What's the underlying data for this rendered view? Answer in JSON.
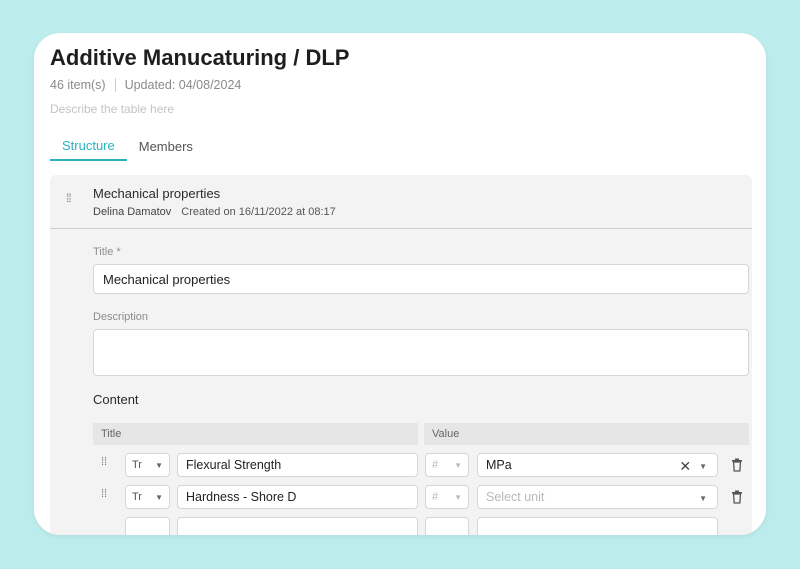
{
  "page": {
    "title": "Additive Manucaturing / DLP",
    "item_count": "46 item(s)",
    "updated": "Updated: 04/08/2024",
    "description_placeholder": "Describe the table here"
  },
  "tabs": [
    {
      "label": "Structure",
      "active": true
    },
    {
      "label": "Members",
      "active": false
    }
  ],
  "section": {
    "title": "Mechanical properties",
    "author": "Delina Damatov",
    "created": "Created on 16/11/2022 at 08:17",
    "form": {
      "title_label": "Title *",
      "title_value": "Mechanical properties",
      "description_label": "Description",
      "description_value": "",
      "content_label": "Content"
    },
    "table": {
      "columns": [
        "Title",
        "Value"
      ],
      "rows": [
        {
          "type_icon": "Tr",
          "title": "Flexural Strength",
          "value_type": "#",
          "unit": "MPa",
          "unit_placeholder": ""
        },
        {
          "type_icon": "Tr",
          "title": "Hardness - Shore D",
          "value_type": "#",
          "unit": "",
          "unit_placeholder": "Select unit"
        }
      ]
    }
  },
  "colors": {
    "accent": "#2bb3c0",
    "background": "#bdecec"
  }
}
